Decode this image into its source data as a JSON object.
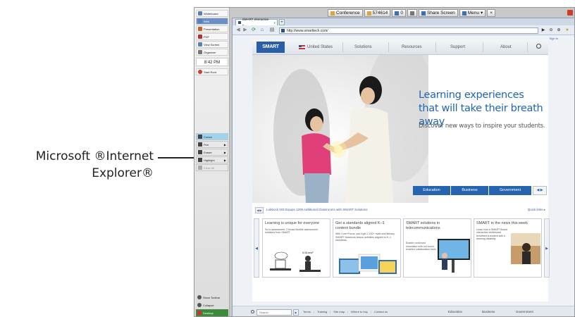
{
  "callout": {
    "line1": "Microsoft ®Internet",
    "line2": "Explorer®"
  },
  "sidebar": {
    "items": [
      {
        "label": "Whiteboard"
      },
      {
        "label": "Web"
      },
      {
        "label": "Presentation"
      },
      {
        "label": "PDF"
      },
      {
        "label": "View Screen"
      },
      {
        "label": "Organizer"
      }
    ],
    "time": "8:42 PM",
    "record": "Start Rcrd",
    "tools": [
      {
        "label": "Cursor"
      },
      {
        "label": "Pen"
      },
      {
        "label": "Eraser"
      },
      {
        "label": "Highlight"
      },
      {
        "label": "Clear All"
      }
    ],
    "bottom": [
      {
        "label": "Show Toolbar"
      },
      {
        "label": "Collapse"
      },
      {
        "label": "Desktop"
      }
    ]
  },
  "conference_bar": {
    "conference": "Conference",
    "session_id": "574614",
    "participants": "0",
    "share_screen": "Share Screen",
    "menu": "Menu"
  },
  "browser": {
    "tab_title": "SMART Interactive E...",
    "url": "http://www.smarttech.com/",
    "sign_in": "Sign In"
  },
  "site": {
    "logo": "SMART",
    "nav": [
      "United States",
      "Solutions",
      "Resources",
      "Support",
      "About"
    ],
    "hero_title": "Learning experiences that will take their breath away",
    "hero_sub": "Discover new ways to inspire your students.",
    "segments": [
      "Education",
      "Business",
      "Government"
    ],
    "ticker": "Lubbock ISD Equips 1200 Additional Classrooms with SMART Solutions",
    "quick_links": "Quick links",
    "cards": [
      {
        "title": "Learning is unique for everyone",
        "body": "So is assessment. Choose flexible assessment solutions from SMART",
        "caption": "9.81m/s²"
      },
      {
        "title": "Get a standards aligned K–1 content bundle",
        "body": "With Core^Focus, you'll get 2,100+ math and literacy SMART Notebook lesson activities aligned to K–1 standards."
      },
      {
        "title": "SMART solutions in telecommunications",
        "body": "Enable continued innovation with our touch-enabled collaboration tools."
      },
      {
        "title": "SMART in the news this week",
        "body": "Learn how a SMART Board interactive whiteboard benefited a student with a learning disability"
      }
    ],
    "footer": {
      "search_placeholder": "Search",
      "links": [
        "Terms",
        "Training",
        "Site map",
        "Where to buy",
        "Contact us"
      ],
      "segments": [
        "Education",
        "Business",
        "Government"
      ]
    }
  },
  "colors": {
    "brand_blue": "#2664b0",
    "hero_title": "#1e66b0",
    "record_red": "#d23b2e"
  }
}
